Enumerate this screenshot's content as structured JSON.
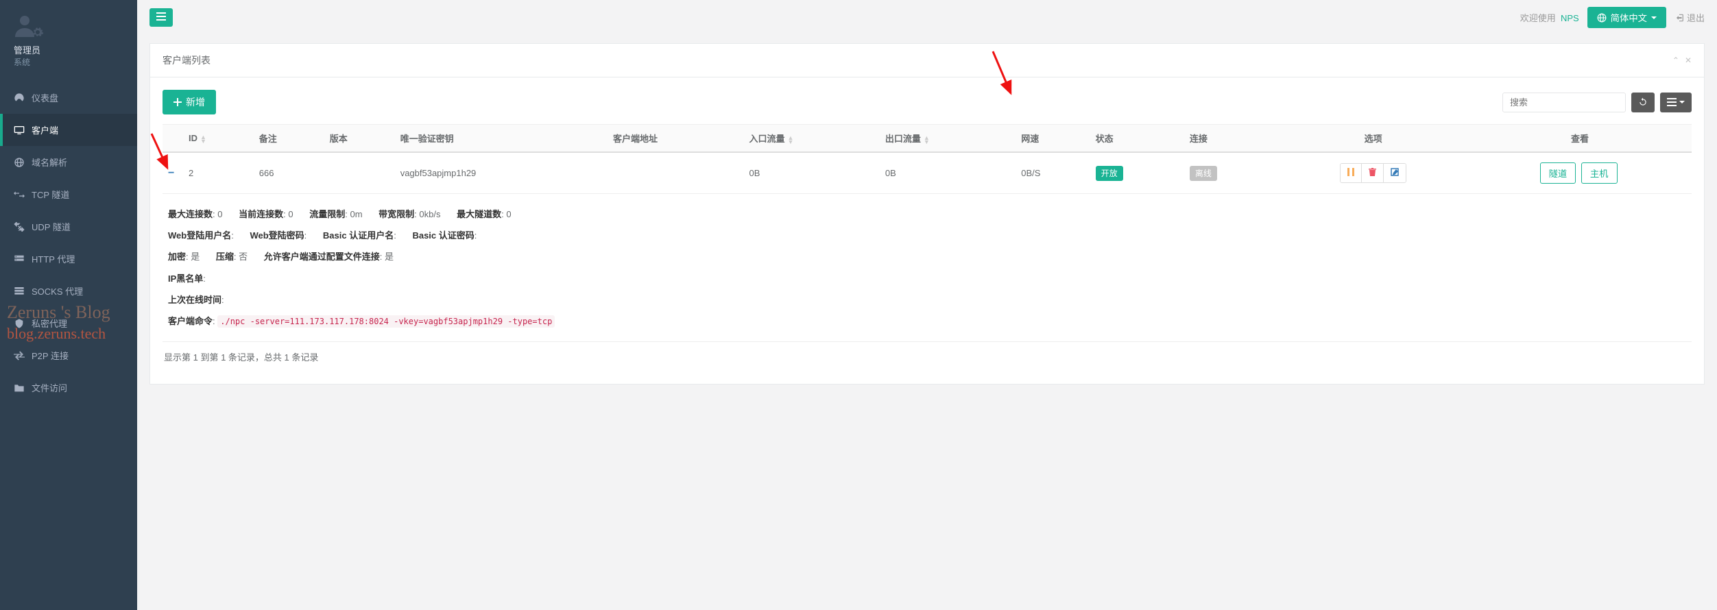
{
  "user": {
    "role": "管理员",
    "sub": "系统"
  },
  "sidebar": {
    "items": [
      {
        "icon": "dashboard-icon",
        "label": "仪表盘"
      },
      {
        "icon": "client-icon",
        "label": "客户端"
      },
      {
        "icon": "domain-icon",
        "label": "域名解析"
      },
      {
        "icon": "tcp-icon",
        "label": "TCP 隧道"
      },
      {
        "icon": "udp-icon",
        "label": "UDP 隧道"
      },
      {
        "icon": "http-icon",
        "label": "HTTP 代理"
      },
      {
        "icon": "socks-icon",
        "label": "SOCKS 代理"
      },
      {
        "icon": "secret-icon",
        "label": "私密代理"
      },
      {
        "icon": "p2p-icon",
        "label": "P2P 连接"
      },
      {
        "icon": "file-icon",
        "label": "文件访问"
      }
    ],
    "active_index": 1
  },
  "topbar": {
    "welcome": "欢迎使用",
    "product": "NPS",
    "lang": "简体中文",
    "logout": "退出"
  },
  "panel": {
    "title": "客户端列表"
  },
  "toolbar": {
    "add_label": "新增",
    "search_placeholder": "搜索"
  },
  "table": {
    "headers": {
      "id": "ID",
      "remark": "备注",
      "version": "版本",
      "vkey": "唯一验证密钥",
      "addr": "客户端地址",
      "in": "入口流量",
      "out": "出口流量",
      "speed": "网速",
      "status": "状态",
      "conn": "连接",
      "options": "选项",
      "view": "查看"
    },
    "rows": [
      {
        "id": "2",
        "remark": "666",
        "version": "",
        "vkey": "vagbf53apjmp1h29",
        "addr": "",
        "in": "0B",
        "out": "0B",
        "speed": "0B/S",
        "status": "开放",
        "conn": "离线"
      }
    ],
    "view_buttons": {
      "tunnel": "隧道",
      "host": "主机"
    }
  },
  "details": {
    "max_conn_label": "最大连接数",
    "max_conn": "0",
    "cur_conn_label": "当前连接数",
    "cur_conn": "0",
    "flow_limit_label": "流量限制",
    "flow_limit": "0m",
    "bw_limit_label": "带宽限制",
    "bw_limit": "0kb/s",
    "max_tunnel_label": "最大隧道数",
    "max_tunnel": "0",
    "web_user_label": "Web登陆用户名",
    "web_user": "",
    "web_pass_label": "Web登陆密码",
    "web_pass": "",
    "basic_user_label": "Basic 认证用户名",
    "basic_user": "",
    "basic_pass_label": "Basic 认证密码",
    "basic_pass": "",
    "crypt_label": "加密",
    "crypt": "是",
    "compress_label": "压缩",
    "compress": "否",
    "config_conn_label": "允许客户端通过配置文件连接",
    "config_conn": "是",
    "ip_blacklist_label": "IP黑名单",
    "ip_blacklist": "",
    "last_online_label": "上次在线时间",
    "last_online": "",
    "cmd_label": "客户端命令",
    "cmd": "./npc -server=111.173.117.178:8024 -vkey=vagbf53apjmp1h29 -type=tcp"
  },
  "footer": {
    "text": "显示第 1 到第 1 条记录，总共 1 条记录"
  },
  "watermark": {
    "line1": "Zeruns 's Blog",
    "line2": "blog.zeruns.tech"
  }
}
